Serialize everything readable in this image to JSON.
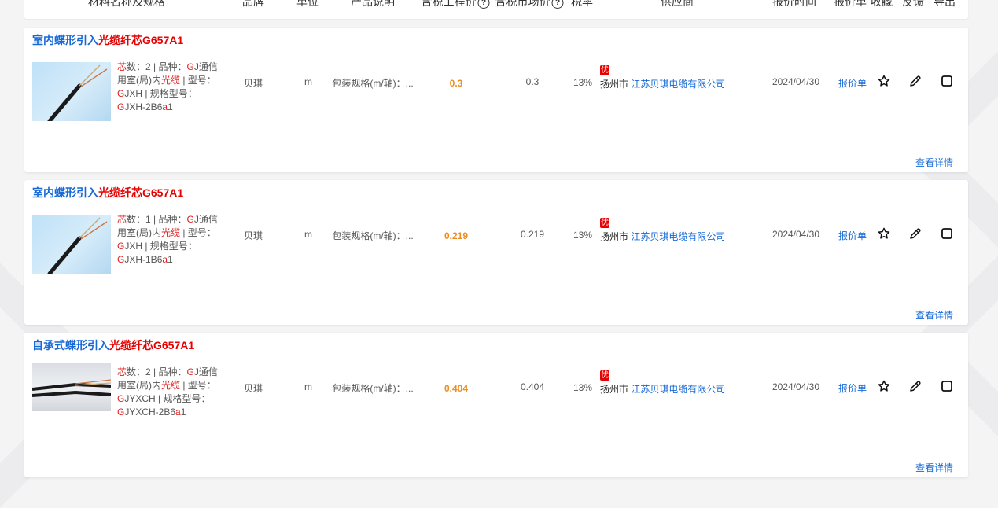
{
  "header": {
    "col_name": "材料名称及规格",
    "col_brand": "品牌",
    "col_unit": "单位",
    "col_desc": "产品说明",
    "col_eng_price": "含税工程价",
    "col_mkt_price": "含税市场价",
    "col_tax": "税率",
    "col_supplier": "供应商",
    "col_time": "报价时间",
    "col_quote": "报价单",
    "col_fav": "收藏",
    "col_feedback": "反馈",
    "col_export": "导出",
    "help_glyph": "?"
  },
  "products": [
    {
      "title_pre": "室内蝶形引入",
      "title_hl": "光缆纤芯",
      "title_post": "G657A1",
      "spec": {
        "core_label": "芯",
        "core_rest": "数：",
        "core_val": "2",
        "sep1": " | 品种：",
        "var_r": "G",
        "var_a": "J通信用室(局)内",
        "var_r2": "光缆",
        "var_b": " | 型号：",
        "model_r": "G",
        "model_rest": "JXH | 规格型号：",
        "spec_r": "G",
        "spec_mid": "JXH-2B6",
        "spec_r2": "a",
        "spec_end": "1"
      },
      "brand": "贝琪",
      "unit": "m",
      "desc": "包装规格(m/轴)：...",
      "eng_price": "0.3",
      "mkt_price": "0.3",
      "tax": "13%",
      "badge": "优",
      "city": "扬州市",
      "company": "江苏贝琪电缆有限公司",
      "date": "2024/04/30",
      "quote_link": "报价单",
      "detail_link": "查看详情"
    },
    {
      "title_pre": "室内蝶形引入",
      "title_hl": "光缆纤芯",
      "title_post": "G657A1",
      "spec": {
        "core_label": "芯",
        "core_rest": "数：",
        "core_val": "1",
        "sep1": " | 品种：",
        "var_r": "G",
        "var_a": "J通信用室(局)内",
        "var_r2": "光缆",
        "var_b": " | 型号：",
        "model_r": "G",
        "model_rest": "JXH | 规格型号：",
        "spec_r": "G",
        "spec_mid": "JXH-1B6",
        "spec_r2": "a",
        "spec_end": "1"
      },
      "brand": "贝琪",
      "unit": "m",
      "desc": "包装规格(m/轴)：...",
      "eng_price": "0.219",
      "mkt_price": "0.219",
      "tax": "13%",
      "badge": "优",
      "city": "扬州市",
      "company": "江苏贝琪电缆有限公司",
      "date": "2024/04/30",
      "quote_link": "报价单",
      "detail_link": "查看详情"
    },
    {
      "title_pre": "自承式蝶形引入",
      "title_hl": "光缆纤芯",
      "title_post": "G657A1",
      "spec": {
        "core_label": "芯",
        "core_rest": "数：",
        "core_val": "2",
        "sep1": " | 品种：",
        "var_r": "G",
        "var_a": "J通信用室(局)内",
        "var_r2": "光缆",
        "var_b": " | 型号：",
        "model_r": "G",
        "model_rest": "JYXCH | 规格型号：",
        "spec_r": "G",
        "spec_mid": "JYXCH-2B6",
        "spec_r2": "a",
        "spec_end": "1"
      },
      "brand": "贝琪",
      "unit": "m",
      "desc": "包装规格(m/轴)：...",
      "eng_price": "0.404",
      "mkt_price": "0.404",
      "tax": "13%",
      "badge": "优",
      "city": "扬州市",
      "company": "江苏贝琪电缆有限公司",
      "date": "2024/04/30",
      "quote_link": "报价单",
      "detail_link": "查看详情"
    }
  ],
  "icons": {
    "favorite": "star-outline",
    "feedback": "pencil",
    "export": "checkbox"
  },
  "colors": {
    "link_blue": "#1769d6",
    "highlight_red": "#e60000",
    "price_orange": "#f08c1e"
  }
}
